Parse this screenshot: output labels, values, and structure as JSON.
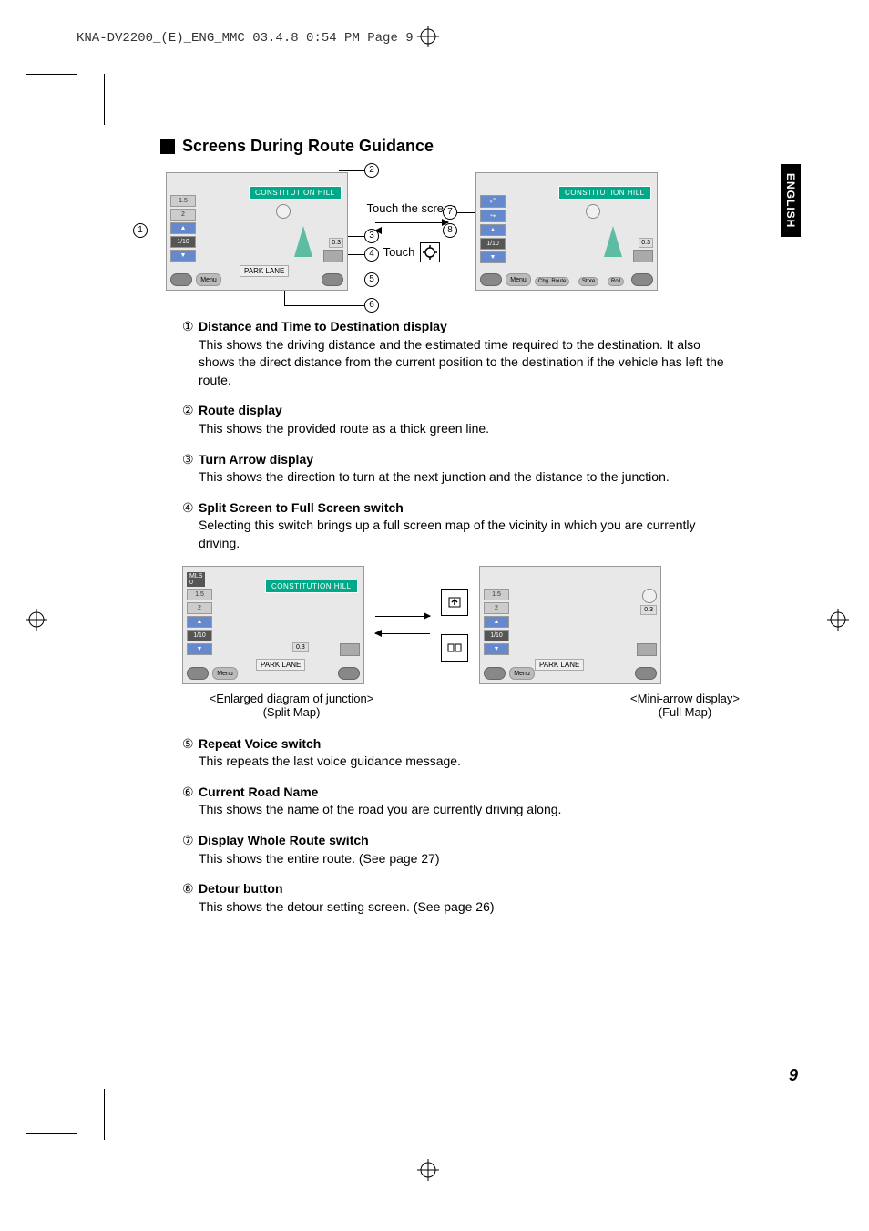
{
  "header": "KNA-DV2200_(E)_ENG_MMC  03.4.8  0:54 PM  Page 9",
  "langTab": "ENGLISH",
  "section_title": "Screens During Route Guidance",
  "figure1": {
    "road_label_top": "CONSTITUTION HILL",
    "road_label_bottom": "PARK LANE",
    "side_scale_1": "1.5",
    "side_scale_2": "2",
    "side_dist": "1/10",
    "menu_label": "Menu",
    "junction_dist": "0.3",
    "touch_screen": "Touch the screen",
    "touch_label": "Touch",
    "chg_route": "Chg. Route",
    "store": "Store",
    "roll": "Roll"
  },
  "items": [
    {
      "num": "①",
      "title": "Distance and Time to Destination display",
      "desc": "This shows the driving distance and the estimated time required to the destination. It also shows the direct distance from the current position to the destination if the vehicle has left the route."
    },
    {
      "num": "②",
      "title": "Route display",
      "desc": "This shows the provided route as a thick green line."
    },
    {
      "num": "③",
      "title": "Turn Arrow display",
      "desc": "This shows the direction to turn at the next junction and the distance to the junction."
    },
    {
      "num": "④",
      "title": "Split Screen to Full Screen switch",
      "desc": "Selecting this switch brings up a full screen map of the vicinity in which you are currently driving."
    }
  ],
  "figure2": {
    "road_label_top": "CONSTITUTION HILL",
    "road_label_bottom": "PARK LANE",
    "menu_label": "Menu",
    "junction_dist": "0.3",
    "side_scale_1": "1.5",
    "side_scale_2": "2",
    "side_dist": "1/10",
    "caption_left_1": "<Enlarged diagram of junction>",
    "caption_left_2": "(Split Map)",
    "caption_right_1": "<Mini-arrow display>",
    "caption_right_2": "(Full Map)"
  },
  "items2": [
    {
      "num": "⑤",
      "title": "Repeat Voice switch",
      "desc": "This repeats the last voice guidance message."
    },
    {
      "num": "⑥",
      "title": "Current Road Name",
      "desc": "This shows the name of the road you are currently driving along."
    },
    {
      "num": "⑦",
      "title": "Display Whole Route switch",
      "desc": "This shows the entire route. (See page 27)"
    },
    {
      "num": "⑧",
      "title": "Detour button",
      "desc": "This shows the detour setting screen. (See page 26)"
    }
  ],
  "page_number": "9"
}
